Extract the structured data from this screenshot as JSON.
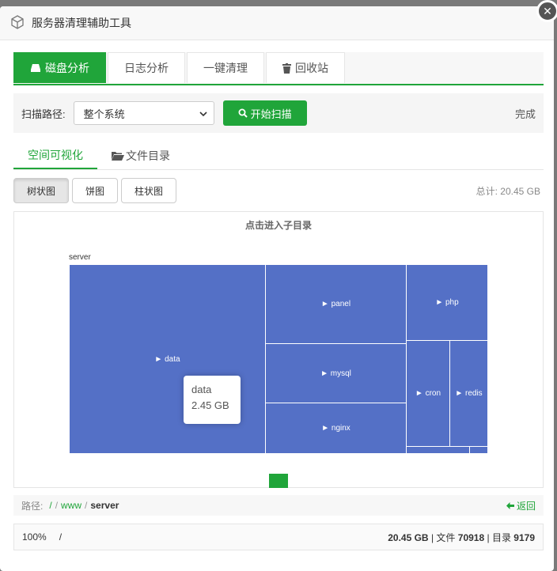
{
  "window": {
    "title": "服务器清理辅助工具",
    "close_label": "✕"
  },
  "tabs": [
    {
      "label": "磁盘分析",
      "active": true
    },
    {
      "label": "日志分析"
    },
    {
      "label": "一键清理"
    },
    {
      "label": "回收站"
    }
  ],
  "scan": {
    "path_label": "扫描路径:",
    "path_value": "整个系统",
    "button_label": "开始扫描",
    "status": "完成"
  },
  "subtabs": [
    {
      "label": "空间可视化",
      "active": true
    },
    {
      "label": "文件目录"
    }
  ],
  "view_buttons": [
    {
      "label": "树状图",
      "active": true
    },
    {
      "label": "饼图"
    },
    {
      "label": "柱状图"
    }
  ],
  "total": "总计: 20.45 GB",
  "chart_data": {
    "type": "treemap",
    "hint": "点击进入子目录",
    "root": "server",
    "nodes": [
      {
        "name": "► data"
      },
      {
        "name": "► panel"
      },
      {
        "name": "► php"
      },
      {
        "name": "► mysql"
      },
      {
        "name": "► nginx"
      },
      {
        "name": "► cron"
      },
      {
        "name": "► redis"
      }
    ],
    "tooltip": {
      "name": "data",
      "value": "2.45 GB"
    },
    "colors": {
      "node": "#5470c6",
      "accent": "#20a53a"
    }
  },
  "path": {
    "label": "路径:",
    "segments": [
      "/",
      "www",
      "server"
    ],
    "back_label": "返回"
  },
  "footer": {
    "zoom": "100%",
    "path": "/",
    "size": "20.45 GB",
    "files_label": "文件",
    "files": "70918",
    "dirs_label": "目录",
    "dirs": "9179"
  }
}
